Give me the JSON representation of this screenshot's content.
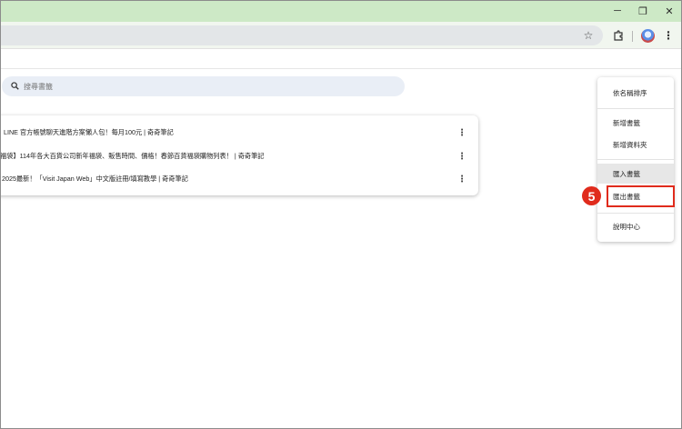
{
  "window": {
    "minimize": "─",
    "restore": "❐",
    "close": "✕"
  },
  "toolbar": {
    "star_icon": "star-icon",
    "extensions_icon": "puzzle-icon",
    "menu_icon": "kebab-icon"
  },
  "search": {
    "placeholder": "搜尋書籤",
    "value": "搜尋書籤"
  },
  "bookmarks": [
    {
      "title": "LINE 官方帳號聊天進階方案懶人包！每月100元 | 奇奇筆記"
    },
    {
      "title": "福袋】114年各大百貨公司新年福袋、販售時間、價格！春節百貨福袋購物列表！ | 奇奇筆記"
    },
    {
      "title": "2025最新！「Visit Japan Web」中文版註冊/填寫教學 | 奇奇筆記"
    }
  ],
  "menu": {
    "items": [
      {
        "label": "依名稱排序"
      },
      {
        "label": "新增書籤"
      },
      {
        "label": "新增資料夾"
      },
      {
        "label": "匯入書籤"
      },
      {
        "label": "匯出書籤"
      },
      {
        "label": "說明中心"
      }
    ]
  },
  "annotation": {
    "step": "5",
    "color": "#e02b1c"
  }
}
